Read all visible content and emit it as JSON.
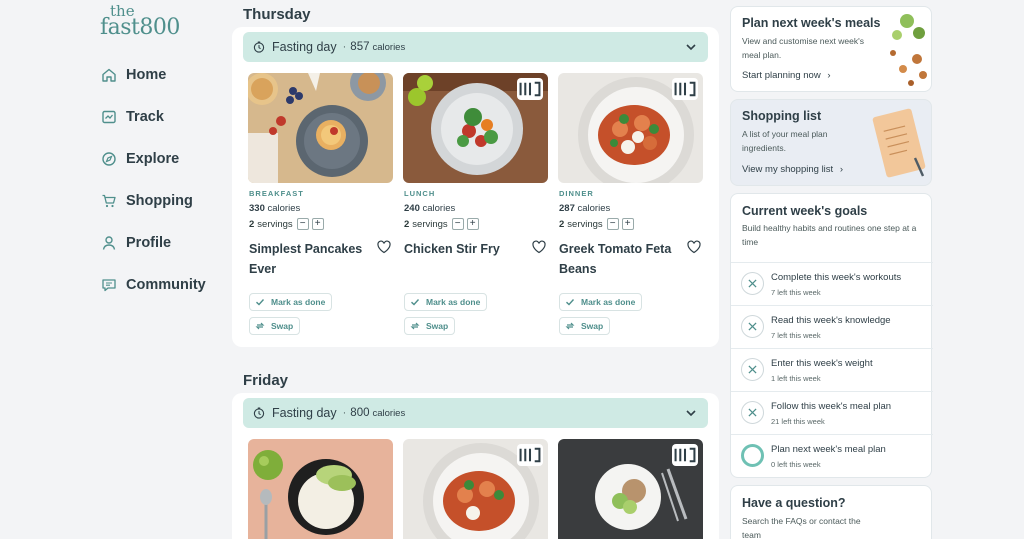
{
  "logo": {
    "line1": "the",
    "line2": "fast800"
  },
  "nav": [
    {
      "label": "Home",
      "icon": "home-icon"
    },
    {
      "label": "Track",
      "icon": "track-icon"
    },
    {
      "label": "Explore",
      "icon": "compass-icon"
    },
    {
      "label": "Shopping",
      "icon": "cart-icon"
    },
    {
      "label": "Profile",
      "icon": "user-icon"
    },
    {
      "label": "Community",
      "icon": "chat-icon"
    }
  ],
  "days": [
    {
      "title": "Thursday",
      "fasting_label": "Fasting day",
      "calories": "857",
      "calories_unit": "calories",
      "meals": [
        {
          "type": "BREAKFAST",
          "calories": "330",
          "calories_unit": "calories",
          "servings": "2",
          "servings_unit": "servings",
          "name": "Simplest Pancakes Ever",
          "done_label": "Mark as done",
          "swap_label": "Swap"
        },
        {
          "type": "LUNCH",
          "calories": "240",
          "calories_unit": "calories",
          "servings": "2",
          "servings_unit": "servings",
          "name": "Chicken Stir Fry",
          "done_label": "Mark as done",
          "swap_label": "Swap"
        },
        {
          "type": "DINNER",
          "calories": "287",
          "calories_unit": "calories",
          "servings": "2",
          "servings_unit": "servings",
          "name": "Greek Tomato Feta Beans",
          "done_label": "Mark as done",
          "swap_label": "Swap"
        }
      ]
    },
    {
      "title": "Friday",
      "fasting_label": "Fasting day",
      "calories": "800",
      "calories_unit": "calories"
    }
  ],
  "plan_panel": {
    "title": "Plan next week's meals",
    "text": "View and customise next week's meal plan.",
    "link": "Start planning now"
  },
  "shopping_panel": {
    "title": "Shopping list",
    "text": "A list of your meal plan ingredients.",
    "link": "View my shopping list"
  },
  "goals_panel": {
    "title": "Current week's goals",
    "text": "Build healthy habits and routines one step at a time",
    "goals": [
      {
        "label": "Complete this week's workouts",
        "sub": "7 left this week",
        "state": "incomplete"
      },
      {
        "label": "Read this week's knowledge",
        "sub": "7 left this week",
        "state": "incomplete"
      },
      {
        "label": "Enter this week's weight",
        "sub": "1 left this week",
        "state": "incomplete"
      },
      {
        "label": "Follow this week's meal plan",
        "sub": "21 left this week",
        "state": "incomplete"
      },
      {
        "label": "Plan next week's meal plan",
        "sub": "0 left this week",
        "state": "open"
      }
    ]
  },
  "question_panel": {
    "title": "Have a question?",
    "text": "Search the FAQs or contact the team"
  },
  "colors": {
    "accent": "#4f8f8c",
    "fasting_bar": "#cfeae4",
    "goal_open": "#6fc1b4",
    "background": "#f3f4f6"
  }
}
